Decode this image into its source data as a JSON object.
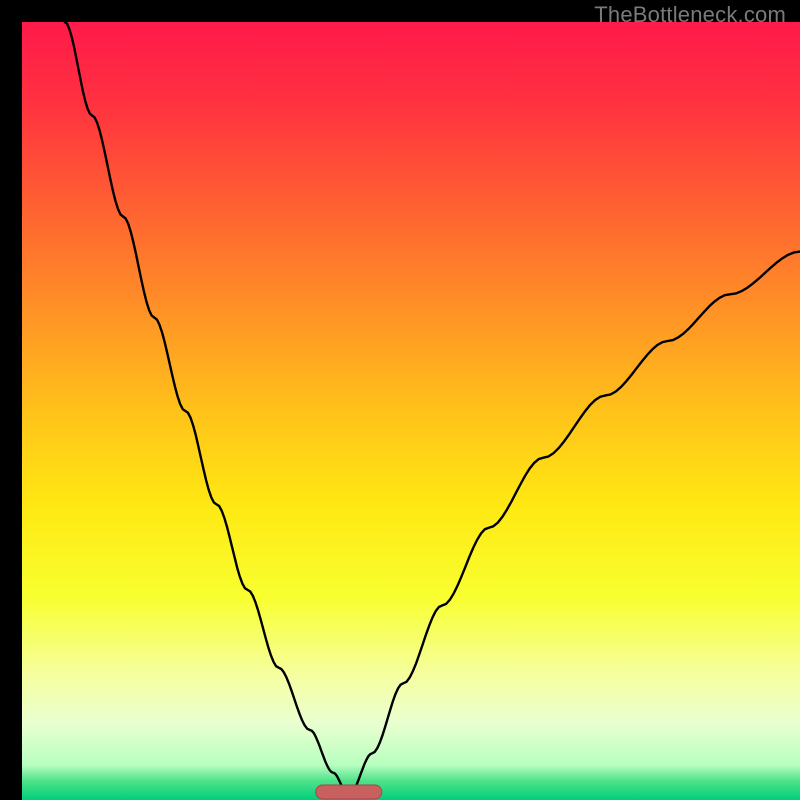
{
  "watermark": {
    "text": "TheBottleneck.com"
  },
  "gradient": {
    "stops": [
      {
        "offset": 0.0,
        "color": "#ff1a4a"
      },
      {
        "offset": 0.1,
        "color": "#ff3040"
      },
      {
        "offset": 0.22,
        "color": "#ff5a33"
      },
      {
        "offset": 0.35,
        "color": "#ff8a28"
      },
      {
        "offset": 0.5,
        "color": "#ffc21a"
      },
      {
        "offset": 0.62,
        "color": "#ffe812"
      },
      {
        "offset": 0.74,
        "color": "#f8ff30"
      },
      {
        "offset": 0.84,
        "color": "#f5ffa0"
      },
      {
        "offset": 0.9,
        "color": "#eaffd0"
      },
      {
        "offset": 0.955,
        "color": "#b8ffc0"
      },
      {
        "offset": 0.975,
        "color": "#50e28a"
      },
      {
        "offset": 1.0,
        "color": "#00cf7a"
      }
    ]
  },
  "marker": {
    "x_frac": 0.42,
    "width_frac": 0.085,
    "color": "#c86060",
    "stroke": "#a04848"
  },
  "curve": {
    "min_x_frac": 0.42,
    "left_start_x_frac": 0.055,
    "right_end_x_frac": 1.0,
    "right_end_y_frac": 0.295,
    "stroke": "#000000",
    "width": 2.4
  },
  "chart_data": {
    "type": "line",
    "title": "",
    "xlabel": "",
    "ylabel": "",
    "x_range_frac": [
      0,
      1
    ],
    "y_range_frac": [
      0,
      1
    ],
    "note": "Values are fractions of the plot area (0=left/top, 1=right/bottom). The curve is V-shaped reaching y≈1 (bottom/green) at x≈0.42; left branch rises to the top-left corner; right branch rises to about y≈0.30 at x=1.",
    "series": [
      {
        "name": "left-branch",
        "x": [
          0.055,
          0.09,
          0.13,
          0.17,
          0.21,
          0.25,
          0.29,
          0.33,
          0.37,
          0.4,
          0.42
        ],
        "y": [
          0.0,
          0.12,
          0.25,
          0.38,
          0.5,
          0.62,
          0.73,
          0.83,
          0.91,
          0.965,
          0.995
        ]
      },
      {
        "name": "right-branch",
        "x": [
          0.42,
          0.45,
          0.49,
          0.54,
          0.6,
          0.67,
          0.75,
          0.83,
          0.91,
          1.0
        ],
        "y": [
          0.995,
          0.94,
          0.85,
          0.75,
          0.65,
          0.56,
          0.48,
          0.41,
          0.35,
          0.295
        ]
      }
    ],
    "marker_region_x_frac": [
      0.38,
      0.465
    ],
    "background_gradient": "vertical red→orange→yellow→pale→green"
  }
}
